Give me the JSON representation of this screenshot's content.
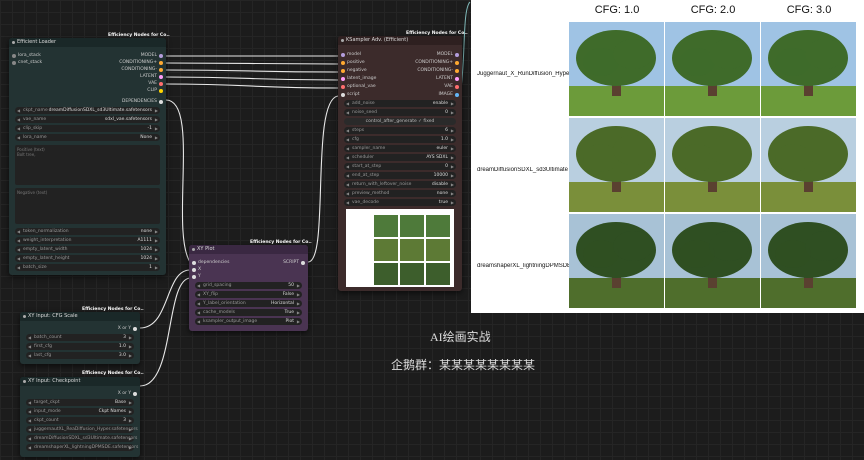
{
  "loader": {
    "badge": "Efficiency Nodes for Co..",
    "title": "Efficient Loader",
    "inputs": [
      "lora_stack",
      "cnet_stack"
    ],
    "outputs": [
      "MODEL",
      "CONDITIONING+",
      "CONDITIONING-",
      "LATENT",
      "VAE",
      "CLIP",
      "DEPENDENCIES"
    ],
    "widgets": [
      {
        "k": "ckpt_name",
        "v": "dreamDiffusionSDXL_sd3Ultimate.safetensors"
      },
      {
        "k": "vae_name",
        "v": "sdxl_vae.safetensors"
      },
      {
        "k": "clip_skip",
        "v": "-1"
      },
      {
        "k": "lora_name",
        "v": "None"
      }
    ],
    "positive_text": "Positive (text)\nBolt tree,",
    "negative_text": "Negative (text)",
    "widgets2": [
      {
        "k": "token_normalization",
        "v": "none"
      },
      {
        "k": "weight_interpretation",
        "v": "A1111"
      },
      {
        "k": "empty_latent_width",
        "v": "1024"
      },
      {
        "k": "empty_latent_height",
        "v": "1024"
      },
      {
        "k": "batch_size",
        "v": "1"
      }
    ]
  },
  "sampler": {
    "badge": "Efficiency Nodes for Co..",
    "title": "KSampler Adv. (Efficient)",
    "inputs": [
      "model",
      "positive",
      "negative",
      "latent_image",
      "optional_vae",
      "script"
    ],
    "outputs": [
      "MODEL",
      "CONDITIONING+",
      "CONDITIONING-",
      "LATENT",
      "VAE",
      "IMAGE"
    ],
    "widgets": [
      {
        "k": "add_noise",
        "v": "enable"
      },
      {
        "k": "noise_seed",
        "v": "0"
      }
    ],
    "button": "control_after_generate ✓ fixed",
    "widgets2": [
      {
        "k": "steps",
        "v": "6"
      },
      {
        "k": "cfg",
        "v": "1.0"
      },
      {
        "k": "sampler_name",
        "v": "euler"
      },
      {
        "k": "scheduler",
        "v": "AYS SDXL"
      },
      {
        "k": "start_at_step",
        "v": "0"
      },
      {
        "k": "end_at_step",
        "v": "10000"
      },
      {
        "k": "return_with_leftover_noise",
        "v": "disable"
      },
      {
        "k": "preview_method",
        "v": "none"
      },
      {
        "k": "vae_decode",
        "v": "true"
      }
    ]
  },
  "xyplot": {
    "badge": "Efficiency Nodes for Co..",
    "title": "XY Plot",
    "inputs": [
      "dependencies",
      "X",
      "Y"
    ],
    "outputs": [
      "SCRIPT"
    ],
    "widgets": [
      {
        "k": "grid_spacing",
        "v": "50"
      },
      {
        "k": "XY_flip",
        "v": "False"
      },
      {
        "k": "Y_label_orientation",
        "v": "Horizontal"
      },
      {
        "k": "cache_models",
        "v": "True"
      },
      {
        "k": "ksampler_output_image",
        "v": "Plot"
      }
    ]
  },
  "cfgnode": {
    "badge": "Efficiency Nodes for Co..",
    "title": "XY Input: CFG Scale",
    "output": "X or Y",
    "widgets": [
      {
        "k": "batch_count",
        "v": "3"
      },
      {
        "k": "first_cfg",
        "v": "1.0"
      },
      {
        "k": "last_cfg",
        "v": "3.0"
      }
    ]
  },
  "ckptnode": {
    "badge": "Efficiency Nodes for Co..",
    "title": "XY Input: Checkpoint",
    "output": "X or Y",
    "widgets": [
      {
        "k": "target_ckpt",
        "v": "Base"
      },
      {
        "k": "input_mode",
        "v": "Ckpt Names"
      },
      {
        "k": "ckpt_count",
        "v": "3"
      },
      {
        "k": "ckpt_name_1",
        "v": "juggernautXL_ReaDiffusion_Hyper.safetensors"
      },
      {
        "k": "ckpt_name_2",
        "v": "dreamDiffusionSDXL_sd3Ultimate.safetensors"
      },
      {
        "k": "ckpt_name_3",
        "v": "dreamshaperXL_lightningDPMSDE.safetensors"
      }
    ]
  },
  "plot": {
    "columns": [
      "CFG: 1.0",
      "CFG: 2.0",
      "CFG: 3.0"
    ],
    "rows": [
      "Juggernaut_X_RunDiffusion_Hyper",
      "dreamDiffusionSDXL_sd3Ultimate",
      "dreamshaperXL_lightningDPMSDE"
    ]
  },
  "overlay": {
    "title": "AI绘画实战",
    "subtitle": "企鹅群：某某某某某某某某"
  },
  "colors": {
    "loader_bg": "#233333",
    "sampler_bg": "#3c2b2b",
    "xyplot_bg": "#4a3452",
    "input_bg": "#233333",
    "wire": "#e8e8e8"
  }
}
